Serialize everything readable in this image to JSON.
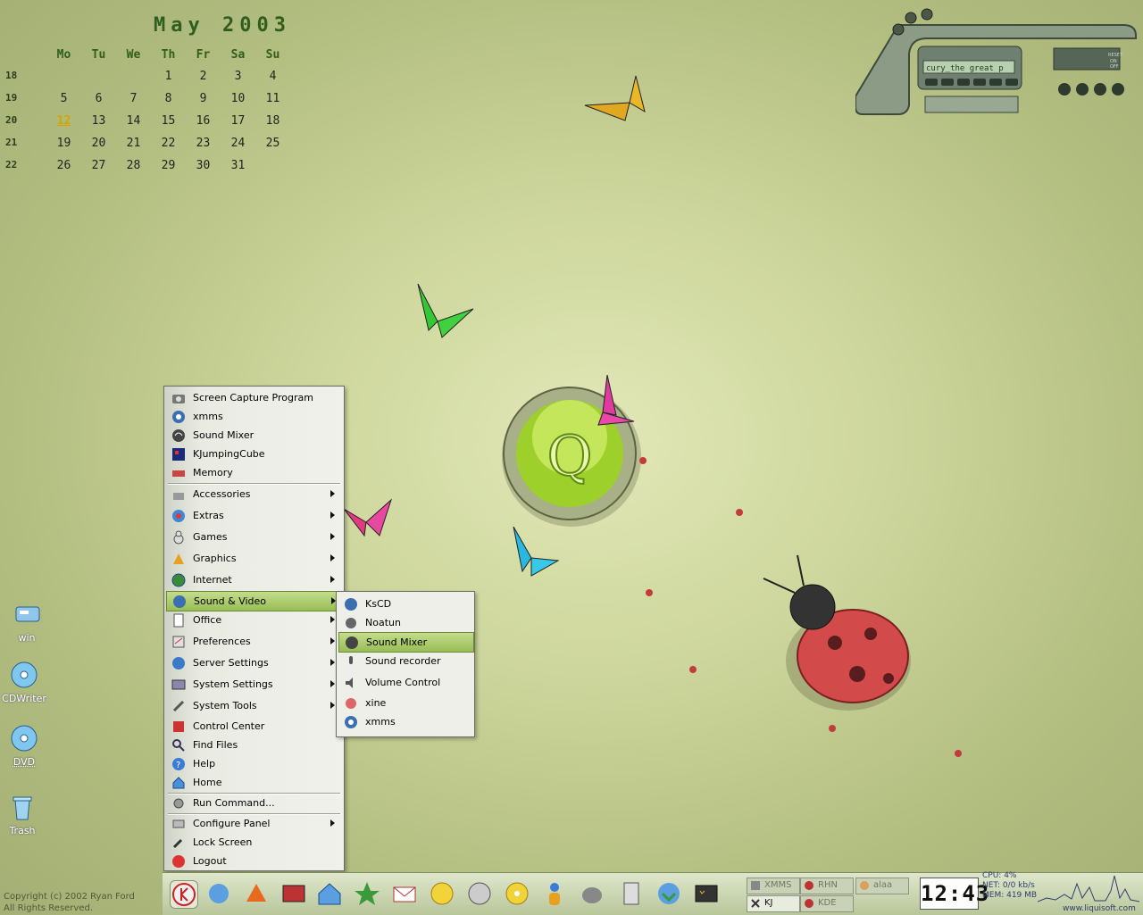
{
  "calendar": {
    "title": "May 2003",
    "days": [
      "Mo",
      "Tu",
      "We",
      "Th",
      "Fr",
      "Sa",
      "Su"
    ],
    "weeks": [
      {
        "num": "18",
        "dates": [
          "",
          "",
          "",
          "1",
          "2",
          "3",
          "4"
        ]
      },
      {
        "num": "19",
        "dates": [
          "5",
          "6",
          "7",
          "8",
          "9",
          "10",
          "11"
        ]
      },
      {
        "num": "20",
        "dates": [
          "12",
          "13",
          "14",
          "15",
          "16",
          "17",
          "18"
        ]
      },
      {
        "num": "21",
        "dates": [
          "19",
          "20",
          "21",
          "22",
          "23",
          "24",
          "25"
        ]
      },
      {
        "num": "22",
        "dates": [
          "26",
          "27",
          "28",
          "29",
          "30",
          "31",
          ""
        ]
      }
    ],
    "today": "12"
  },
  "player": {
    "track_text": "cury_the great p",
    "status_labels": [
      "RESET",
      "ON",
      "OFF"
    ]
  },
  "desktop_icons": [
    {
      "label": "win",
      "icon": "drive-icon"
    },
    {
      "label": "CDWriter",
      "icon": "cd-drive-icon"
    },
    {
      "label": "DVD",
      "icon": "dvd-drive-icon"
    },
    {
      "label": "Trash",
      "icon": "trash-icon"
    }
  ],
  "kmenu": {
    "recent": [
      "Screen Capture Program",
      "xmms",
      "Sound Mixer",
      "KJumpingCube",
      "Memory"
    ],
    "categories": [
      "Accessories",
      "Extras",
      "Games",
      "Graphics",
      "Internet",
      "Sound & Video",
      "Office",
      "Preferences",
      "Server Settings",
      "System Settings",
      "System Tools"
    ],
    "actions": [
      "Control Center",
      "Find Files",
      "Help",
      "Home"
    ],
    "run": "Run Command...",
    "session": [
      "Configure Panel",
      "Lock Screen",
      "Logout"
    ]
  },
  "submenu": {
    "items": [
      "KsCD",
      "Noatun",
      "Sound Mixer",
      "Sound recorder",
      "Volume Control",
      "xine",
      "xmms"
    ]
  },
  "taskbar": {
    "tasks": [
      {
        "label": "XMMS"
      },
      {
        "label": "RHN"
      },
      {
        "label": "alaa"
      },
      {
        "label": "KJ"
      },
      {
        "label": "KDE"
      }
    ],
    "clock": "12:43",
    "cpu": "CPU: 4%",
    "net": "NET: 0/0 kb/s",
    "mem": "MEM: 419 MB",
    "url": "www.liquisoft.com"
  },
  "copyright": {
    "line1": "Copyright (c) 2002 Ryan Ford",
    "line2": "All Rights Reserved."
  },
  "colors": {
    "accent": "#98bd55",
    "calendar_text": "#2f5e1e",
    "today": "#d6a400"
  }
}
